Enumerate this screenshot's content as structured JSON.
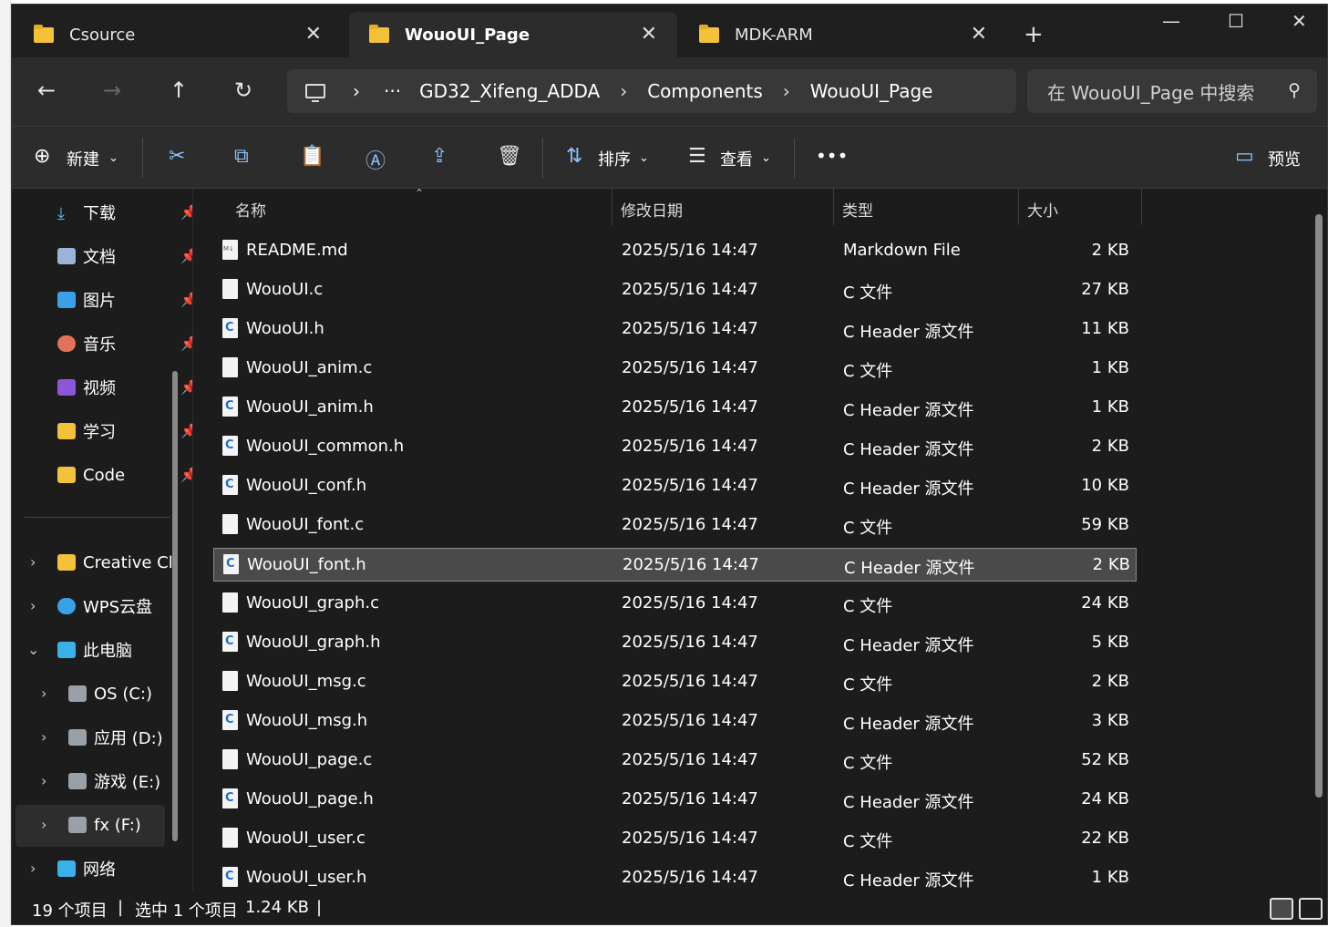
{
  "tabs": [
    {
      "label": "Csource",
      "active": false
    },
    {
      "label": "WouoUI_Page",
      "active": true
    },
    {
      "label": "MDK-ARM",
      "active": false
    }
  ],
  "window_controls": {
    "minimize": "—",
    "maximize": "☐",
    "close": "✕",
    "new_tab": "+"
  },
  "nav": {
    "back": "←",
    "forward": "→",
    "up": "↑",
    "refresh": "↻",
    "breadcrumb": {
      "more": "···",
      "items": [
        "GD32_Xifeng_ADDA",
        "Components",
        "WouoUI_Page"
      ]
    },
    "search_placeholder": "在 WouoUI_Page 中搜索"
  },
  "toolbar": {
    "new_label": "新建",
    "sort_label": "排序",
    "view_label": "查看",
    "more": "•••",
    "preview_label": "预览"
  },
  "sidebar": {
    "quick_access": [
      {
        "label": "下载",
        "icon": "download-icon"
      },
      {
        "label": "文档",
        "icon": "documents-icon"
      },
      {
        "label": "图片",
        "icon": "pictures-icon"
      },
      {
        "label": "音乐",
        "icon": "music-icon"
      },
      {
        "label": "视频",
        "icon": "videos-icon"
      },
      {
        "label": "学习",
        "icon": "folder-icon"
      },
      {
        "label": "Code",
        "icon": "folder-icon"
      }
    ],
    "tree": [
      {
        "label": "Creative Cl",
        "icon": "folder-icon"
      },
      {
        "label": "WPS云盘",
        "icon": "cloud-icon"
      },
      {
        "label": "此电脑",
        "icon": "computer-icon"
      },
      {
        "label": "OS (C:)",
        "icon": "drive-icon"
      },
      {
        "label": "应用 (D:)",
        "icon": "drive-icon"
      },
      {
        "label": "游戏 (E:)",
        "icon": "drive-icon"
      },
      {
        "label": "fx (F:)",
        "icon": "drive-icon"
      },
      {
        "label": "网络",
        "icon": "network-icon"
      }
    ]
  },
  "columns": {
    "name": "名称",
    "modified": "修改日期",
    "type": "类型",
    "size": "大小"
  },
  "files": [
    {
      "name": "README.md",
      "modified": "2025/5/16 14:47",
      "type": "Markdown File",
      "size": "2 KB"
    },
    {
      "name": "WouoUI.c",
      "modified": "2025/5/16 14:47",
      "type": "C 文件",
      "size": "27 KB"
    },
    {
      "name": "WouoUI.h",
      "modified": "2025/5/16 14:47",
      "type": "C Header 源文件",
      "size": "11 KB"
    },
    {
      "name": "WouoUI_anim.c",
      "modified": "2025/5/16 14:47",
      "type": "C 文件",
      "size": "1 KB"
    },
    {
      "name": "WouoUI_anim.h",
      "modified": "2025/5/16 14:47",
      "type": "C Header 源文件",
      "size": "1 KB"
    },
    {
      "name": "WouoUI_common.h",
      "modified": "2025/5/16 14:47",
      "type": "C Header 源文件",
      "size": "2 KB"
    },
    {
      "name": "WouoUI_conf.h",
      "modified": "2025/5/16 14:47",
      "type": "C Header 源文件",
      "size": "10 KB"
    },
    {
      "name": "WouoUI_font.c",
      "modified": "2025/5/16 14:47",
      "type": "C 文件",
      "size": "59 KB"
    },
    {
      "name": "WouoUI_font.h",
      "modified": "2025/5/16 14:47",
      "type": "C Header 源文件",
      "size": "2 KB"
    },
    {
      "name": "WouoUI_graph.c",
      "modified": "2025/5/16 14:47",
      "type": "C 文件",
      "size": "24 KB"
    },
    {
      "name": "WouoUI_graph.h",
      "modified": "2025/5/16 14:47",
      "type": "C Header 源文件",
      "size": "5 KB"
    },
    {
      "name": "WouoUI_msg.c",
      "modified": "2025/5/16 14:47",
      "type": "C 文件",
      "size": "2 KB"
    },
    {
      "name": "WouoUI_msg.h",
      "modified": "2025/5/16 14:47",
      "type": "C Header 源文件",
      "size": "3 KB"
    },
    {
      "name": "WouoUI_page.c",
      "modified": "2025/5/16 14:47",
      "type": "C 文件",
      "size": "52 KB"
    },
    {
      "name": "WouoUI_page.h",
      "modified": "2025/5/16 14:47",
      "type": "C Header 源文件",
      "size": "24 KB"
    },
    {
      "name": "WouoUI_user.c",
      "modified": "2025/5/16 14:47",
      "type": "C 文件",
      "size": "22 KB"
    },
    {
      "name": "WouoUI_user.h",
      "modified": "2025/5/16 14:47",
      "type": "C Header 源文件",
      "size": "1 KB"
    }
  ],
  "selected_file": "WouoUI_font.h",
  "status": {
    "count": "19 个项目",
    "selection": "选中 1 个项目",
    "selection_size": "1.24 KB"
  }
}
